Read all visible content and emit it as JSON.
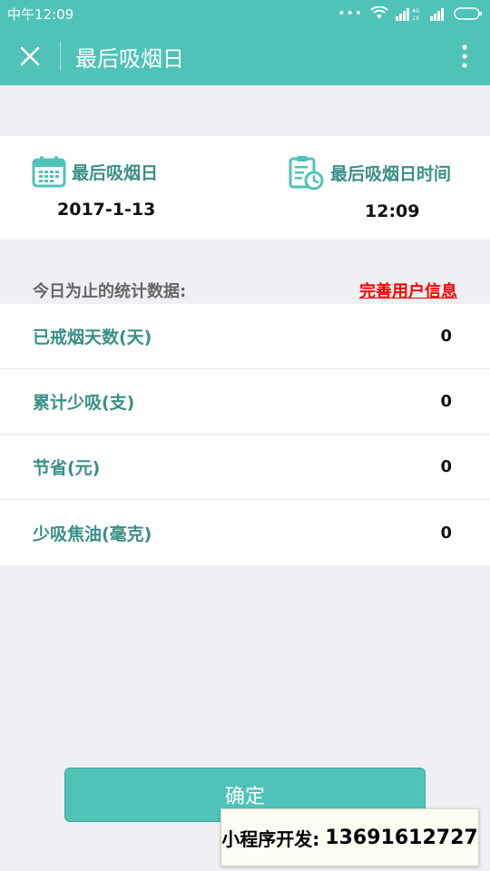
{
  "status_bar": {
    "time": "中午12:09",
    "network_badge": "4G\n1X"
  },
  "titlebar": {
    "title": "最后吸烟日"
  },
  "last_smoke": {
    "date_label": "最后吸烟日",
    "date_value": "2017-1-13",
    "time_label": "最后吸烟日时间",
    "time_value": "12:09"
  },
  "stats": {
    "header": "今日为止的统计数据:",
    "complete_profile_link": "完善用户信息",
    "rows": [
      {
        "label": "已戒烟天数(天)",
        "value": "0"
      },
      {
        "label": "累计少吸(支)",
        "value": "0"
      },
      {
        "label": "节省(元)",
        "value": "0"
      },
      {
        "label": "少吸焦油(毫克)",
        "value": "0"
      }
    ]
  },
  "confirm_button": "确定",
  "watermark": {
    "label": "小程序开发:",
    "phone": "13691612727"
  },
  "colors": {
    "accent": "#4fc3b8",
    "label": "#3a8f86",
    "link": "#ff0000"
  }
}
